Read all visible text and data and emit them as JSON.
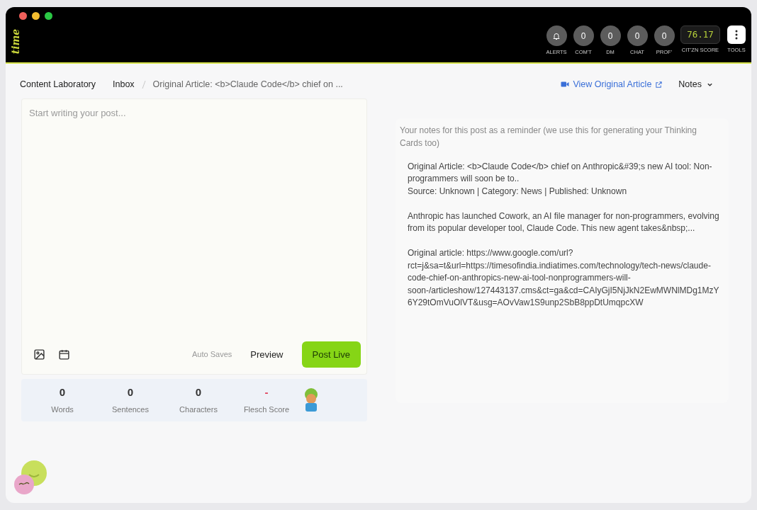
{
  "app": {
    "logo": "time"
  },
  "counters": [
    {
      "kind": "icon",
      "label": "ALERTS"
    },
    {
      "kind": "count",
      "value": "0",
      "label": "COM'T"
    },
    {
      "kind": "count",
      "value": "0",
      "label": "DM"
    },
    {
      "kind": "count",
      "value": "0",
      "label": "CHAT"
    },
    {
      "kind": "count",
      "value": "0",
      "label": "PROF'"
    }
  ],
  "score": {
    "value": "76.17",
    "label": "CIT'ZN SCORE"
  },
  "tools": {
    "label": "TOOLS"
  },
  "breadcrumbs": [
    "Content Laboratory",
    "Inbox",
    "Original Article: <b>Claude Code</b> chief on ..."
  ],
  "view_original": "View Original Article",
  "notes_menu": "Notes",
  "editor": {
    "placeholder": "Start writing your post...",
    "auto_saves": "Auto Saves",
    "preview": "Preview",
    "post_live": "Post Live"
  },
  "stats": [
    {
      "value": "0",
      "label": "Words"
    },
    {
      "value": "0",
      "label": "Sentences"
    },
    {
      "value": "0",
      "label": "Characters"
    },
    {
      "value": "-",
      "label": "Flesch Score"
    }
  ],
  "notes": {
    "hint": "Your notes for this post as a reminder (we use this for generating your Thinking Cards too)",
    "blocks": [
      [
        "Original Article: <b>Claude Code</b> chief on Anthropic&#39;s new AI tool: Non-programmers will soon be to..",
        "Source: Unknown | Category: News | Published: Unknown"
      ],
      [
        "Anthropic has launched Cowork, an AI file manager for non-programmers, evolving from its popular developer tool, Claude Code. This new agent takes&nbsp;..."
      ],
      [
        "Original article: https://www.google.com/url?rct=j&sa=t&url=https://timesofindia.indiatimes.com/technology/tech-news/claude-code-chief-on-anthropics-new-ai-tool-nonprogrammers-will-soon-/articleshow/127443137.cms&ct=ga&cd=CAIyGjI5NjJkN2EwMWNlMDg1MzY6Y29tOmVuOlVT&usg=AOvVaw1S9unp2SbB8ppDtUmqpcXW"
      ]
    ]
  }
}
